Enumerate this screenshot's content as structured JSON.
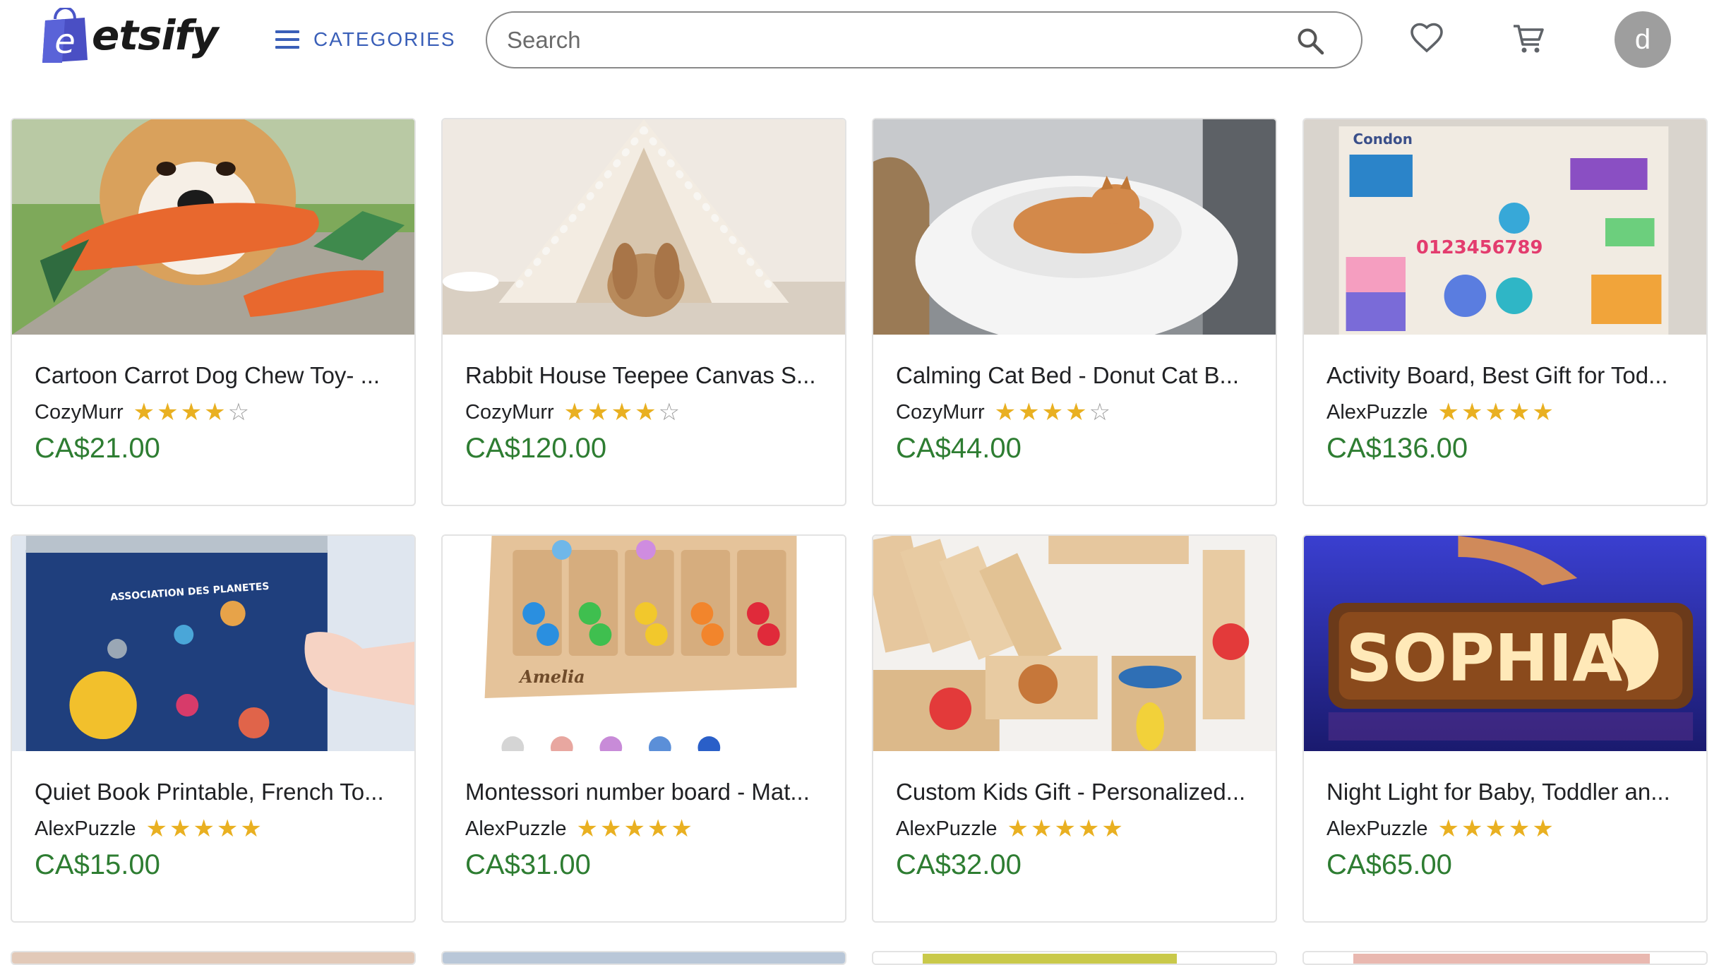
{
  "header": {
    "logo_text": "etsify",
    "logo_letter": "e",
    "categories_label": "CATEGORIES",
    "search_placeholder": "Search",
    "avatar_letter": "d"
  },
  "colors": {
    "brand": "#3a5fb8",
    "price": "#2e7d32",
    "star": "#e9b021"
  },
  "products": [
    {
      "title": "Cartoon Carrot Dog Chew Toy- ...",
      "seller": "CozyMurr",
      "rating": 4,
      "price": "CA$21.00",
      "image": "dog-with-carrot-toy"
    },
    {
      "title": "Rabbit House Teepee Canvas S...",
      "seller": "CozyMurr",
      "rating": 4,
      "price": "CA$120.00",
      "image": "rabbit-in-teepee"
    },
    {
      "title": "Calming Cat Bed - Donut Cat B...",
      "seller": "CozyMurr",
      "rating": 4,
      "price": "CA$44.00",
      "image": "cat-in-fluffy-bed"
    },
    {
      "title": "Activity Board, Best Gift for Tod...",
      "seller": "AlexPuzzle",
      "rating": 5,
      "price": "CA$136.00",
      "image": "busy-board"
    },
    {
      "title": "Quiet Book Printable, French To...",
      "seller": "AlexPuzzle",
      "rating": 5,
      "price": "CA$15.00",
      "image": "planets-quiet-book"
    },
    {
      "title": "Montessori number board - Mat...",
      "seller": "AlexPuzzle",
      "rating": 5,
      "price": "CA$31.00",
      "image": "pompom-number-board"
    },
    {
      "title": "Custom Kids Gift - Personalized...",
      "seller": "AlexPuzzle",
      "rating": 5,
      "price": "CA$32.00",
      "image": "wooden-dominoes"
    },
    {
      "title": "Night Light for Baby, Toddler an...",
      "seller": "AlexPuzzle",
      "rating": 5,
      "price": "CA$65.00",
      "image": "sophia-night-light"
    }
  ],
  "image_text": {
    "busy_board_label": "Condon",
    "busy_board_numbers": "0123456789",
    "quiet_book_heading": "ASSOCIATION DES PLANETES",
    "pompom_board_name": "Amelia",
    "night_light_name": "SOPHIA"
  }
}
